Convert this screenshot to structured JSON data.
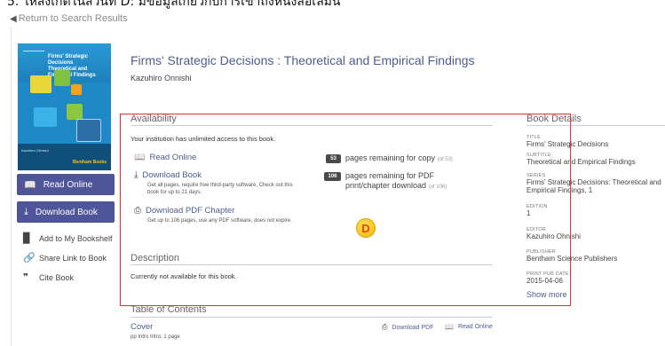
{
  "top_caption": "5. ให้สังเกตในส่วนที่ D: มีข้อมูลเกี่ยวกับการเข้าถึงหนังสือเล่มนี้",
  "back_link": {
    "label": "Return to Search Results",
    "icon": "arrow-left-icon"
  },
  "cover": {
    "title_line1": "Firms' Strategic Decisions",
    "title_line2": "Theoretical and Empirical Findings",
    "author_line": "Kazuhiro Ohnishi",
    "publisher_logo": "Bentham Books"
  },
  "side_actions": {
    "read_online": "Read Online",
    "download_book": "Download Book",
    "add_bookshelf": "Add to My Bookshelf",
    "share_link": "Share Link to Book",
    "cite_book": "Cite Book"
  },
  "book": {
    "title": "Firms' Strategic Decisions : Theoretical and Empirical Findings",
    "author": "Kazuhiro Onnishi"
  },
  "availability": {
    "heading": "Availability",
    "access_note": "Your institution has unlimited access to this book.",
    "read_online": "Read Online",
    "download_book": "Download Book",
    "download_book_note": "Get all pages, require free third-party software, Check out this book for up to 21 days.",
    "download_chapter": "Download PDF Chapter",
    "download_chapter_note": "Get up to 106 pages, use any PDF software, does not expire.",
    "copy_count": "53",
    "copy_text": "pages remaining for copy",
    "copy_of": "(of 53)",
    "pdf_count": "106",
    "pdf_text_1": "pages remaining for PDF",
    "pdf_text_2": "print/chapter download",
    "pdf_of": "(of 106)"
  },
  "description": {
    "heading": "Description",
    "text": "Currently not available for this book."
  },
  "toc": {
    "heading": "Table of Contents",
    "item_title": "Cover",
    "item_meta": "pp Intro Intro; 1 page",
    "download_pdf": "Download PDF",
    "read_online": "Read Online"
  },
  "details": {
    "heading": "Book Details",
    "title_k": "TITLE",
    "title_v": "Firms' Strategic Decisions",
    "subtitle_k": "SUBTITLE",
    "subtitle_v": "Theoretical and Empirical Findings",
    "series_k": "SERIES",
    "series_v1": "Firms' Strategic Decisions: Theoretical and",
    "series_v2": "Empirical Findings, 1",
    "edition_k": "EDITION",
    "edition_v": "1",
    "editor_k": "EDITOR",
    "editor_v": "Kazuhiro Ohnishi",
    "publisher_k": "PUBLISHER",
    "publisher_v": "Bentham Science Publishers",
    "pub_date_k": "PRINT PUB DATE",
    "pub_date_v": "2015-04-06",
    "show_more": "Show more"
  },
  "annotation": {
    "marker": "D",
    "color": "#e1322f"
  }
}
